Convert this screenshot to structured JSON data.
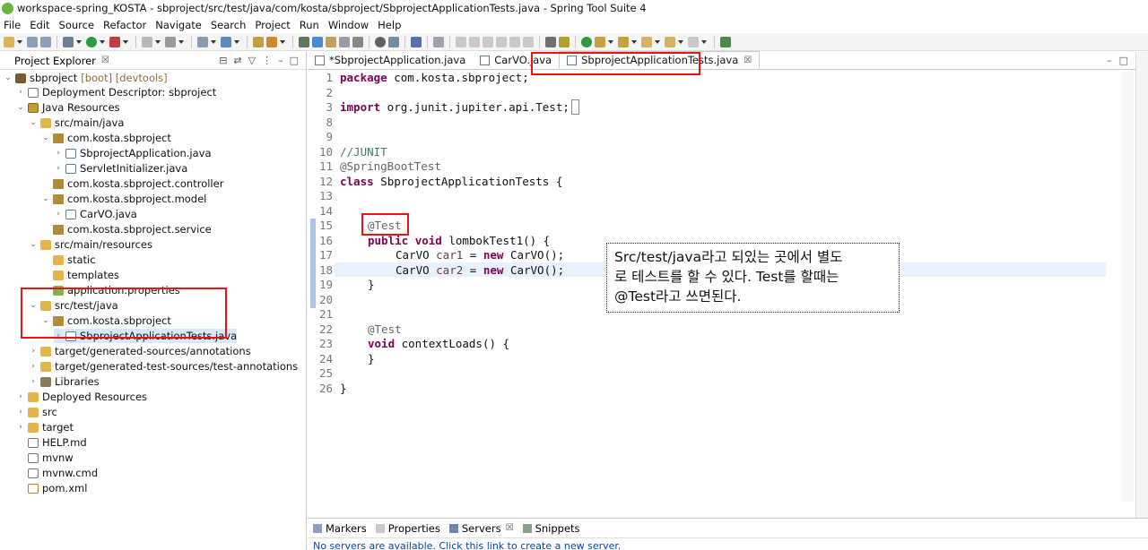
{
  "window": {
    "title": "workspace-spring_KOSTA - sbproject/src/test/java/com/kosta/sbproject/SbprojectApplicationTests.java - Spring Tool Suite 4"
  },
  "menu": [
    "File",
    "Edit",
    "Source",
    "Refactor",
    "Navigate",
    "Search",
    "Project",
    "Run",
    "Window",
    "Help"
  ],
  "explorer": {
    "title": "Project Explorer",
    "close": "☒",
    "items": [
      {
        "label": "sbproject",
        "suffix": "[boot] [devtools]",
        "icon": "project-icon"
      },
      {
        "label": "Deployment Descriptor: sbproject",
        "icon": "descriptor-icon"
      },
      {
        "label": "Java Resources",
        "icon": "java-resources-icon"
      },
      {
        "label": "src/main/java",
        "icon": "source-folder-icon"
      },
      {
        "label": "com.kosta.sbproject",
        "icon": "package-icon"
      },
      {
        "label": "SbprojectApplication.java",
        "icon": "java-file-icon"
      },
      {
        "label": "ServletInitializer.java",
        "icon": "java-file-icon"
      },
      {
        "label": "com.kosta.sbproject.controller",
        "icon": "package-icon"
      },
      {
        "label": "com.kosta.sbproject.model",
        "icon": "package-icon"
      },
      {
        "label": "CarVO.java",
        "icon": "java-file-icon"
      },
      {
        "label": "com.kosta.sbproject.service",
        "icon": "package-icon"
      },
      {
        "label": "src/main/resources",
        "icon": "source-folder-icon"
      },
      {
        "label": "static",
        "icon": "folder-icon"
      },
      {
        "label": "templates",
        "icon": "folder-icon"
      },
      {
        "label": "application.properties",
        "icon": "properties-icon"
      },
      {
        "label": "src/test/java",
        "icon": "source-folder-icon"
      },
      {
        "label": "com.kosta.sbproject",
        "icon": "package-icon"
      },
      {
        "label": "SbprojectApplicationTests.java",
        "icon": "java-file-icon"
      },
      {
        "label": "target/generated-sources/annotations",
        "icon": "source-folder-icon"
      },
      {
        "label": "target/generated-test-sources/test-annotations",
        "icon": "source-folder-icon"
      },
      {
        "label": "Libraries",
        "icon": "library-icon"
      },
      {
        "label": "Deployed Resources",
        "icon": "folder-icon"
      },
      {
        "label": "src",
        "icon": "folder-icon"
      },
      {
        "label": "target",
        "icon": "folder-icon"
      },
      {
        "label": "HELP.md",
        "icon": "file-icon"
      },
      {
        "label": "mvnw",
        "icon": "file-icon"
      },
      {
        "label": "mvnw.cmd",
        "icon": "file-icon"
      },
      {
        "label": "pom.xml",
        "icon": "xml-file-icon"
      }
    ]
  },
  "editor": {
    "tabs": [
      {
        "label": "*SbprojectApplication.java"
      },
      {
        "label": "CarVO.java"
      },
      {
        "label": "SbprojectApplicationTests.java",
        "close": "☒"
      }
    ],
    "line_numbers": [
      "1",
      "2",
      "3",
      "8",
      "9",
      "10",
      "11",
      "12",
      "13",
      "14",
      "15",
      "16",
      "17",
      "18",
      "19",
      "20",
      "21",
      "22",
      "23",
      "24",
      "25",
      "26"
    ],
    "code": {
      "l1_kw": "package",
      "l1_rest": " com.kosta.sbproject;",
      "l3_kw": "import",
      "l3_rest": " org.junit.jupiter.api.Test;",
      "l9": "//JUNIT",
      "l10": "@SpringBootTest",
      "l11_kw": "class",
      "l11_rest": " SbprojectApplicationTests {",
      "l14": "@Test",
      "l15_kw1": "public",
      "l15_kw2": "void",
      "l15_rest": " lombokTest1() {",
      "l16_type": "CarVO ",
      "l16_var": "car1",
      "l16_eq": " = ",
      "l16_kw": "new",
      "l16_rest": " CarVO();",
      "l17_type": "CarVO ",
      "l17_var": "car2",
      "l17_eq": " = ",
      "l17_kw": "new",
      "l17_rest": " CarVO();",
      "l18": "}",
      "l21": "@Test",
      "l22_kw": "void",
      "l22_rest": " contextLoads() {",
      "l23": "}",
      "l25": "}"
    }
  },
  "note": {
    "line1": "Src/test/java라고 되있는 곳에서 별도",
    "line2": "로 테스트를 할 수 있다. Test를 할때는",
    "line3": "@Test라고 쓰면된다."
  },
  "bottom": {
    "tabs": [
      "Markers",
      "Properties",
      "Servers",
      "Snippets"
    ],
    "close": "☒",
    "message": "No servers are available. Click this link to create a new server."
  },
  "colors": {
    "highlight_box": "#ee1111",
    "keyword": "#7f0055",
    "comment": "#3f7f5f",
    "annotation": "#646464"
  }
}
